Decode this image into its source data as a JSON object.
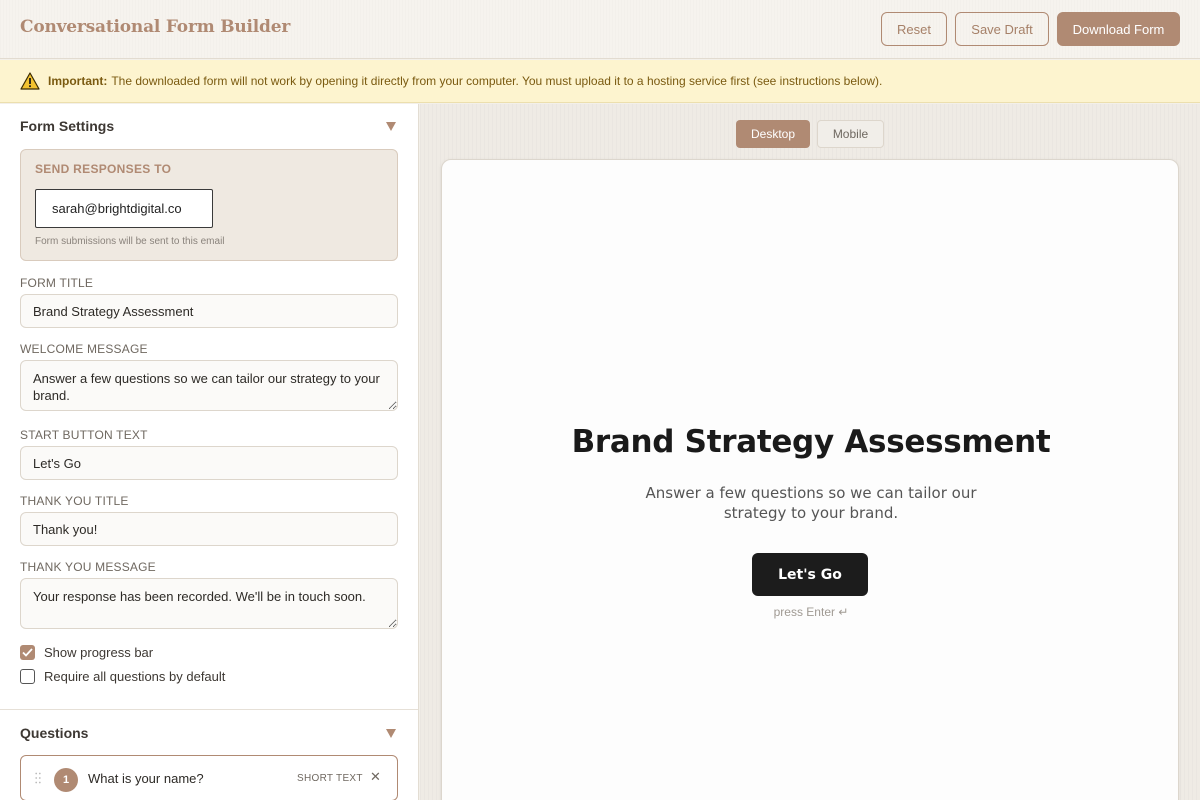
{
  "header": {
    "title": "Conversational Form Builder",
    "reset_label": "Reset",
    "save_draft_label": "Save Draft",
    "download_label": "Download Form"
  },
  "banner": {
    "strong": "Important:",
    "text": "The downloaded form will not work by opening it directly from your computer. You must upload it to a hosting service first (see instructions below)."
  },
  "form_settings": {
    "heading": "Form Settings",
    "send_label": "SEND RESPONSES TO",
    "email_value": "sarah@brightdigital.co",
    "email_help": "Form submissions will be sent to this email",
    "form_title_label": "FORM TITLE",
    "form_title_value": "Brand Strategy Assessment",
    "welcome_label": "WELCOME MESSAGE",
    "welcome_value": "Answer a few questions so we can tailor our strategy to your brand.",
    "start_label": "START BUTTON TEXT",
    "start_value": "Let's Go",
    "thanks_title_label": "THANK YOU TITLE",
    "thanks_title_value": "Thank you!",
    "thanks_msg_label": "THANK YOU MESSAGE",
    "thanks_msg_value": "Your response has been recorded. We'll be in touch soon.",
    "show_progress_label": "Show progress bar",
    "show_progress_checked": true,
    "require_all_label": "Require all questions by default",
    "require_all_checked": false
  },
  "questions": {
    "heading": "Questions",
    "items": [
      {
        "number": "1",
        "text": "What is your name?",
        "type": "SHORT TEXT"
      }
    ]
  },
  "preview": {
    "tabs": [
      "Desktop",
      "Mobile"
    ],
    "active_tab": "Desktop",
    "title": "Brand Strategy Assessment",
    "message": "Answer a few questions so we can tailor our strategy to your brand.",
    "button": "Let's Go",
    "hint": "press Enter ↵"
  },
  "colors": {
    "accent": "#b08a73",
    "banner_bg": "#fdf4cf",
    "preview_button": "#1c1c1c"
  },
  "icons": [
    "warning-icon",
    "chevron-down-icon",
    "check-icon",
    "drag-handle-icon",
    "close-icon"
  ]
}
